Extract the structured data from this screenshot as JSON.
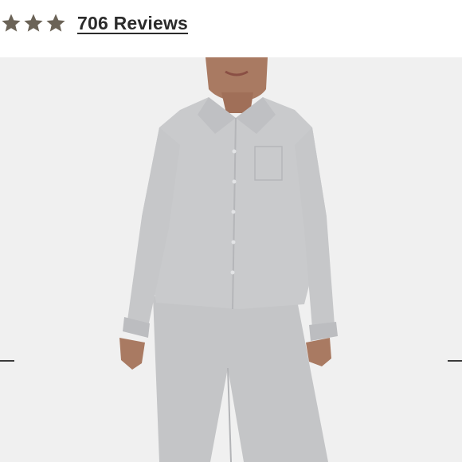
{
  "rating": {
    "stars_filled": 3,
    "star_color": "#6b6357",
    "reviews_label": "706 Reviews"
  },
  "product_image": {
    "background_color": "#f0f0f0",
    "garment_color": "#c9cacc"
  },
  "gallery_nav": {
    "prev_icon": "arrow-left-icon",
    "next_icon": "arrow-right-icon"
  }
}
